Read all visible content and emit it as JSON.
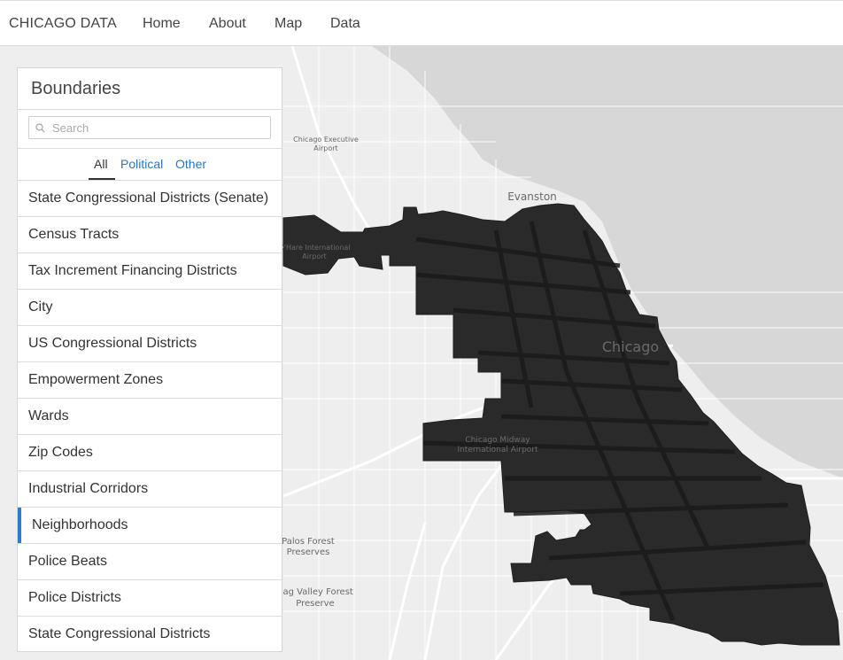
{
  "nav": {
    "brand": "CHICAGO DATA",
    "links": [
      "Home",
      "About",
      "Map",
      "Data"
    ]
  },
  "panel": {
    "title": "Boundaries",
    "search_placeholder": "Search",
    "tabs": [
      "All",
      "Political",
      "Other"
    ],
    "active_tab": "All",
    "items": [
      "State Congressional Districts (Senate)",
      "Census Tracts",
      "Tax Increment Financing Districts",
      "City",
      "US Congressional Districts",
      "Empowerment Zones",
      "Wards",
      "Zip Codes",
      "Industrial Corridors",
      "Neighborhoods",
      "Police Beats",
      "Police Districts",
      "State Congressional Districts"
    ],
    "selected_item": "Neighborhoods"
  },
  "map": {
    "labels": {
      "exec_airport": [
        "Chicago Executive",
        "Airport"
      ],
      "evanston": "Evanston",
      "ohare": [
        "O'Hare International",
        "Airport"
      ],
      "chicago": "Chicago",
      "midway": [
        "Chicago Midway",
        "International Airport"
      ],
      "palos": [
        "Palos Forest",
        "Preserves"
      ],
      "sag": [
        "Sag Valley Forest",
        "Preserve"
      ]
    },
    "colors": {
      "land": "#eeeeee",
      "water": "#d7d7d7",
      "roads": "#ffffff",
      "boundary_fill": "#2a2a2a",
      "accent": "#2a7dd1"
    }
  }
}
